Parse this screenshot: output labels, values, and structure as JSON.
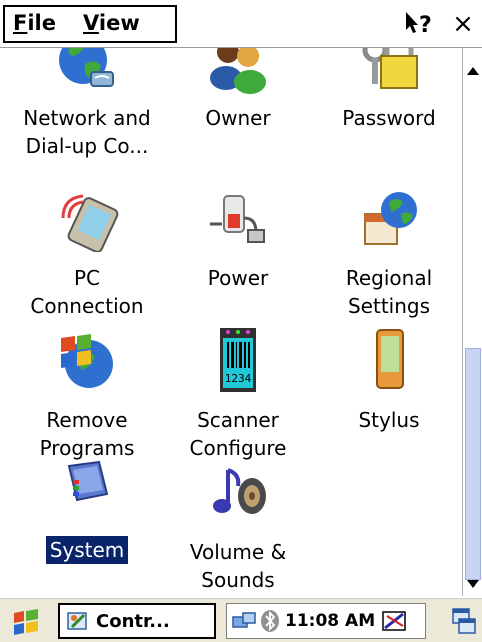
{
  "menubar": {
    "file": "File",
    "file_rest": "ile",
    "file_mnemonic": "F",
    "view": "View",
    "view_mnemonic": "V",
    "view_rest": "iew",
    "help_icon": "help-icon",
    "close_label": "×"
  },
  "applets": [
    {
      "line1": "Network and",
      "line2": "Dial-up Co...",
      "icon": "network-dialup-icon"
    },
    {
      "line1": "Owner",
      "line2": "",
      "icon": "owner-icon"
    },
    {
      "line1": "Password",
      "line2": "",
      "icon": "password-icon"
    },
    {
      "line1": "PC",
      "line2": "Connection",
      "icon": "pc-connection-icon"
    },
    {
      "line1": "Power",
      "line2": "",
      "icon": "power-icon"
    },
    {
      "line1": "Regional",
      "line2": "Settings",
      "icon": "regional-settings-icon"
    },
    {
      "line1": "Remove",
      "line2": "Programs",
      "icon": "remove-programs-icon"
    },
    {
      "line1": "Scanner",
      "line2": "Configure",
      "icon": "scanner-configure-icon"
    },
    {
      "line1": "Stylus",
      "line2": "",
      "icon": "stylus-icon"
    },
    {
      "line1": "System",
      "line2": "",
      "icon": "system-icon"
    },
    {
      "line1": "Volume &",
      "line2": "Sounds",
      "icon": "volume-sounds-icon"
    }
  ],
  "scanner_icon_text": "1234",
  "selected_applet": "System",
  "taskbar": {
    "task_label": "Contr...",
    "clock": "11:08 AM"
  },
  "colors": {
    "selection": "#0a246a",
    "scroll_thumb": "#c9d4f4"
  }
}
